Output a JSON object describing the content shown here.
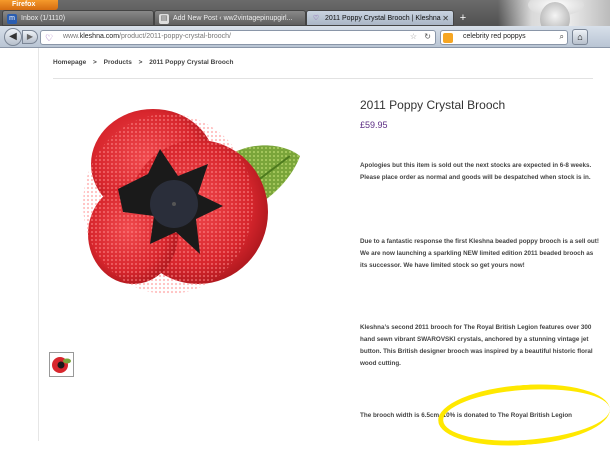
{
  "browser": {
    "menu_button": "Firefox",
    "tabs": [
      {
        "label": "Inbox (1/1110)",
        "icon": "mail-icon"
      },
      {
        "label": "Add New Post ‹ ww2vintagepinupgirl...",
        "icon": "page-icon"
      },
      {
        "label": "2011 Poppy Crystal Brooch | Kleshna",
        "icon": "kleshna-icon"
      }
    ],
    "new_tab": "+",
    "url_prefix": "www.",
    "url_domain": "kleshna.com",
    "url_path": "/product/2011-poppy-crystal-brooch/",
    "search_value": "celebrity red poppys"
  },
  "breadcrumb": {
    "home": "Homepage",
    "sep1": ">",
    "products": "Products",
    "sep2": ">",
    "current": "2011 Poppy Crystal Brooch"
  },
  "product": {
    "title": "2011 Poppy Crystal Brooch",
    "price": "£59.95",
    "paragraphs": [
      "Apologies but this item is sold out the next stocks are expected in 6-8 weeks. Please place order as normal and goods will be despatched when stock is in.",
      "Due to a fantastic response the first Kleshna beaded poppy brooch is a sell out! We are now launching a sparkling NEW limited edition 2011 beaded brooch as its successor. We have limited stock so get yours now!",
      "Kleshna’s second 2011 brooch for The Royal British Legion features over 300 hand sewn vibrant SWAROVSKI crystals, anchored by a stunning vintage jet button. This British designer brooch was inspired by a beautiful historic floral wood cutting.",
      "The brooch width is 6.5cm. 10% is donated to The Royal British Legion"
    ]
  },
  "colors": {
    "price": "#5c2d84",
    "highlight": "#ffe800",
    "poppy_red": "#d8262d",
    "leaf_green": "#7aa53a"
  }
}
